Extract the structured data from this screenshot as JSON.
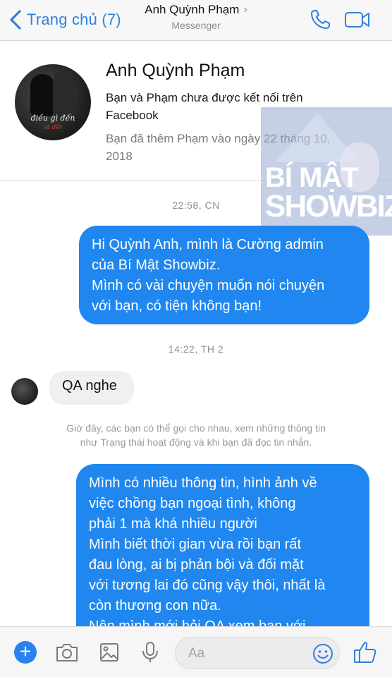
{
  "header": {
    "back_label": "Trang chủ (7)",
    "title": "Anh Quỳnh Phạm",
    "subtitle": "Messenger",
    "accent_color": "#2f7fe0",
    "icons": [
      "back-chevron-icon",
      "call-icon",
      "video-call-icon",
      "title-chevron-icon"
    ]
  },
  "profile": {
    "name": "Anh Quỳnh Phạm",
    "avatar_caption": "điều gì đến",
    "avatar_caption2": "sẽ đến",
    "not_connected_line1": "Bạn và Phạm chưa được kết nối trên",
    "not_connected_line2": "Facebook",
    "added_line1": "Bạn đã thêm Phạm vào ngày 22 tháng 10,",
    "added_line2": "2018"
  },
  "watermark": {
    "line1": "BÍ MẬT",
    "line2": "SHOWBIZ"
  },
  "messages": {
    "timestamp1": "22:58, CN",
    "msg1": [
      "Hi Quỳnh Anh, mình là Cường admin",
      "của Bí Mật Showbiz.",
      "Mình có vài chuyện muốn nói chuyện",
      "với bạn, có tiện không bạn!"
    ],
    "timestamp2": "14:22, TH 2",
    "reply": "QA nghe",
    "notice_line1": "Giờ đây, các bạn có thể gọi cho nhau, xem những thông tin",
    "notice_line2": "như Trạng thái hoạt động và khi bạn đã đọc tin nhắn.",
    "msg2": [
      "Mình có nhiều thông tin, hình ảnh về",
      "việc chồng bạn ngoại tình, không",
      "phải 1 mà khá nhiều người",
      "Mình biết thời gian vừa rồi bạn rất",
      "đau lòng, ai bị phản bội và đối mặt",
      "với tương lai đó cũng vậy thôi, nhất là",
      "còn thương con nữa.",
      "Nên mình mới hỏi QA xem bạn với"
    ],
    "outgoing_color": "#1f87ef"
  },
  "composer": {
    "placeholder": "Aa",
    "icons": [
      "plus-icon",
      "camera-icon",
      "image-icon",
      "microphone-icon",
      "emoji-icon",
      "thumbs-up-icon"
    ]
  }
}
